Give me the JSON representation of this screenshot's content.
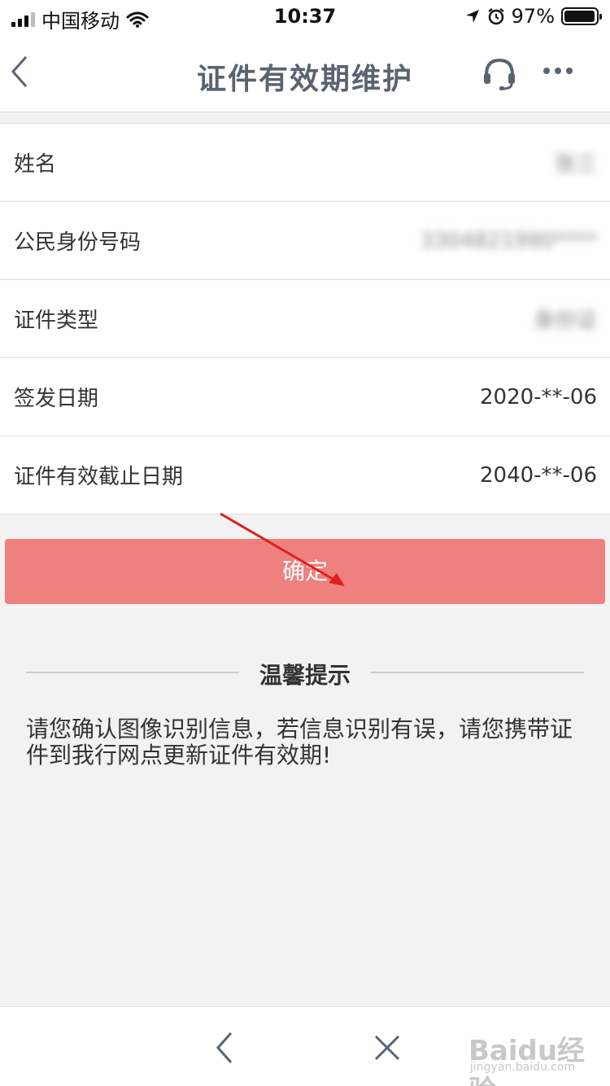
{
  "status_bar": {
    "carrier": "中国移动",
    "time": "10:37",
    "battery_percent": "97%",
    "battery_level": 0.97,
    "icons": [
      "signal-icon",
      "wifi-icon",
      "location-icon",
      "alarm-icon",
      "battery-icon"
    ]
  },
  "nav": {
    "title": "证件有效期维护",
    "icons": [
      "back-icon",
      "headset-icon",
      "more-icon"
    ]
  },
  "form": {
    "rows": [
      {
        "label": "姓名",
        "value": "张三",
        "blurred": true
      },
      {
        "label": "公民身份号码",
        "value": "3304821990****",
        "blurred": true
      },
      {
        "label": "证件类型",
        "value": "身份证",
        "blurred": true
      },
      {
        "label": "签发日期",
        "value": "2020-**-06",
        "blurred": false
      },
      {
        "label": "证件有效截止日期",
        "value": "2040-**-06",
        "blurred": false
      }
    ]
  },
  "confirm": {
    "label": "确定"
  },
  "tips": {
    "title": "温馨提示",
    "text": "请您确认图像识别信息，若信息识别有误，请您携带证件到我行网点更新证件有效期!"
  },
  "toolbar": {
    "icons": [
      "back-icon",
      "close-icon"
    ]
  },
  "watermark": {
    "brand": "Baidu经验",
    "sub": "jingyan.baidu.com"
  },
  "colors": {
    "accent": "#ee817e",
    "title": "#5a6470",
    "background": "#f2f2f2",
    "annotation_arrow": "#e02020"
  }
}
